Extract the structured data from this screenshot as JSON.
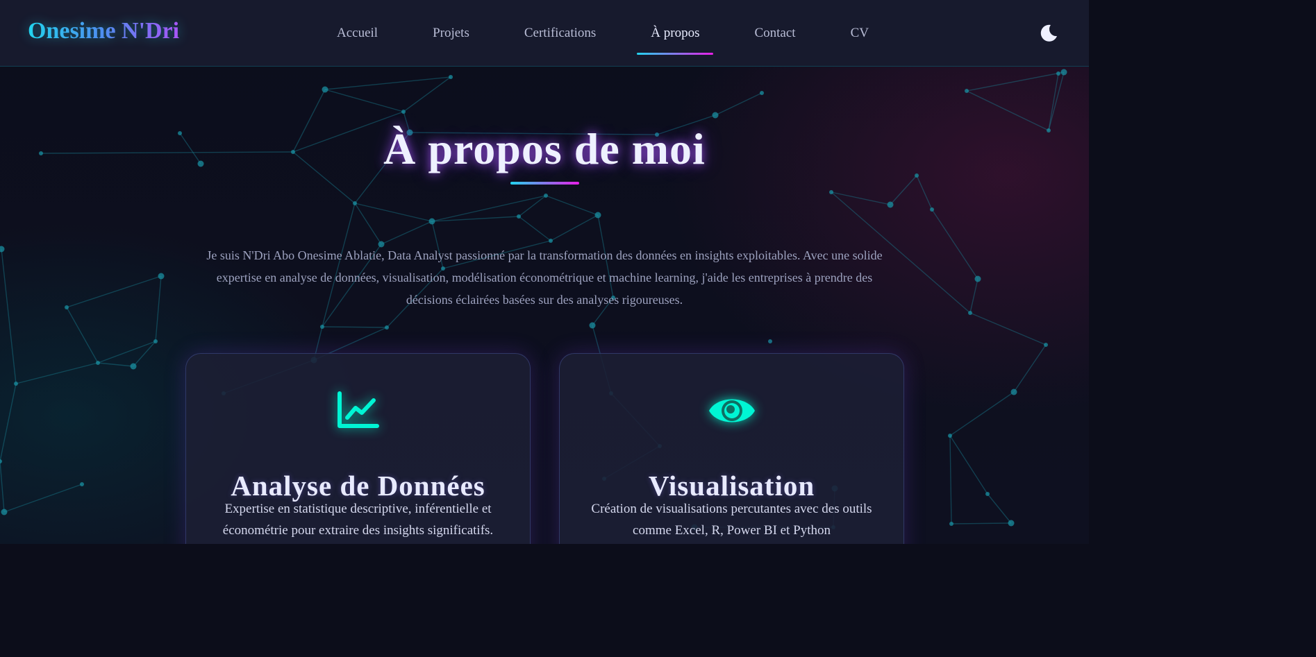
{
  "nav": {
    "logo": "Onesime N'Dri",
    "links": [
      "Accueil",
      "Projets",
      "Certifications",
      "À propos",
      "Contact",
      "CV"
    ],
    "active_index": 3,
    "theme_icon": "moon-icon"
  },
  "about": {
    "title": "À propos de moi",
    "intro": "Je suis N'Dri Abo Onesime Ablatie, Data Analyst passionné par la transformation des données en insights exploitables. Avec une solide expertise en analyse de données, visualisation, modélisation économétrique et machine learning, j'aide les entreprises à prendre des décisions éclairées basées sur des analyses rigoureuses."
  },
  "cards": [
    {
      "icon": "chart-line-icon",
      "title": "Analyse de Données",
      "description": "Expertise en statistique descriptive, inférentielle et économétrie pour extraire des insights significatifs."
    },
    {
      "icon": "eye-icon",
      "title": "Visualisation",
      "description": "Création de visualisations percutantes avec des outils comme Excel, R, Power BI et Python"
    }
  ],
  "colors": {
    "accent_cyan": "#22d3ee",
    "accent_magenta": "#e81ee8",
    "icon_teal": "#00f5d4",
    "background": "#0c0e1c",
    "network": "#1a8fa0"
  }
}
